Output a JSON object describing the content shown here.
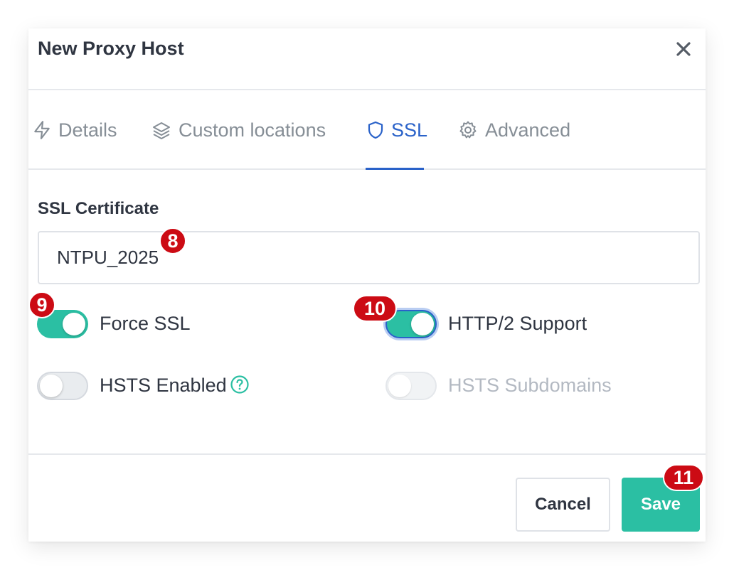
{
  "modal": {
    "title": "New Proxy Host"
  },
  "tabs": [
    {
      "label": "Details",
      "icon": "bolt-icon",
      "active": false
    },
    {
      "label": "Custom locations",
      "icon": "layers-icon",
      "active": false
    },
    {
      "label": "SSL",
      "icon": "shield-icon",
      "active": true
    },
    {
      "label": "Advanced",
      "icon": "gear-icon",
      "active": false
    }
  ],
  "ssl": {
    "certificate_label": "SSL Certificate",
    "certificate_value": "NTPU_2025",
    "force_ssl": {
      "label": "Force SSL",
      "enabled": true
    },
    "http2": {
      "label": "HTTP/2 Support",
      "enabled": true
    },
    "hsts": {
      "label": "HSTS Enabled",
      "enabled": false
    },
    "hsts_subdomains": {
      "label": "HSTS Subdomains",
      "enabled": false,
      "disabled": true
    }
  },
  "footer": {
    "cancel_label": "Cancel",
    "save_label": "Save"
  },
  "badges": {
    "b8": "8",
    "b9": "9",
    "b10": "10",
    "b11": "11"
  },
  "colors": {
    "accent": "#2a62c9",
    "toggle_on": "#2bbfa3",
    "save_button": "#2bbfa3",
    "badge": "#cc0b14"
  }
}
